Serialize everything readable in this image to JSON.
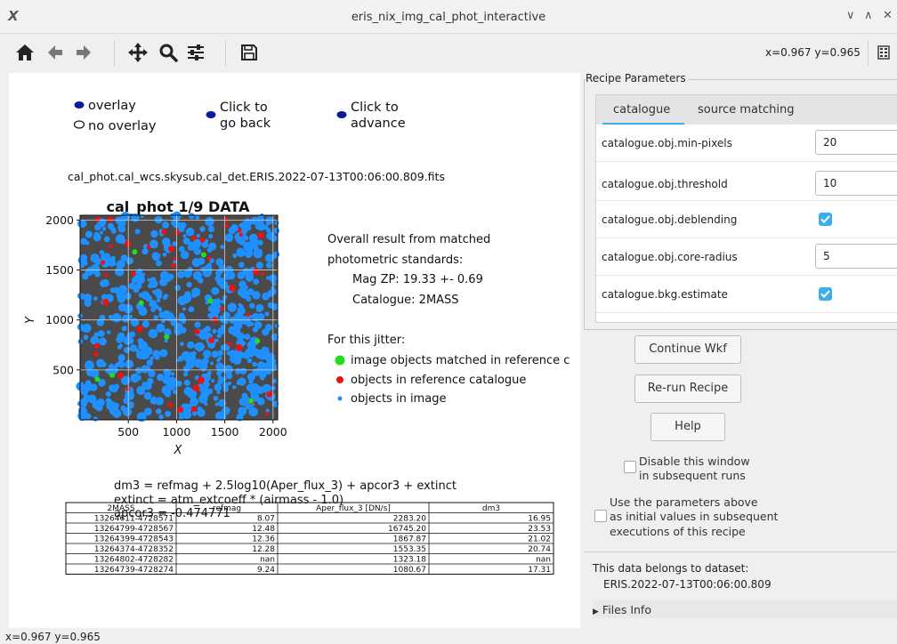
{
  "window": {
    "title": "eris_nix_img_cal_phot_interactive",
    "controls": [
      "∨",
      "∧",
      "✕"
    ]
  },
  "toolbar": {
    "coords": "x=0.967 y=0.965",
    "icons": [
      "home-icon",
      "back-arrow-icon",
      "forward-arrow-icon",
      "pan-icon",
      "zoom-icon",
      "configure-subplots-icon",
      "save-icon"
    ]
  },
  "figure": {
    "buttons": {
      "overlay": "overlay",
      "no_overlay": "no overlay",
      "back": [
        "Click to",
        "go back"
      ],
      "advance": [
        "Click to",
        "advance"
      ]
    },
    "filename": "cal_phot.cal_wcs.skysub.cal_det.ERIS.2022-07-13T00:06:00.809.fits",
    "plot": {
      "title": "cal_phot 1/9 DATA",
      "xlabel": "X",
      "ylabel": "Y",
      "xticks": [
        "500",
        "1000",
        "1500",
        "2000"
      ],
      "yticks": [
        "2000",
        "1500",
        "1000",
        "500"
      ],
      "xtick_values": [
        500,
        1000,
        1500,
        2000
      ],
      "ytick_values": [
        2000,
        1500,
        1000,
        500
      ],
      "xlim": [
        0,
        2048
      ],
      "ylim": [
        0,
        2048
      ]
    },
    "info": {
      "line1": "Overall result from matched",
      "line2": "photometric standards:",
      "line3": "Mag ZP: 19.33 +- 0.69",
      "line4": "Catalogue: 2MASS",
      "line5": "For this jitter:"
    },
    "legend": [
      {
        "label": "image objects matched in reference c",
        "color": "#22dd22"
      },
      {
        "label": "objects in reference catalogue",
        "color": "#ee1111"
      },
      {
        "label": "objects in image",
        "color": "#1e90ff"
      }
    ],
    "formula": {
      "line1": "dm3 = refmag + 2.5log10(Aper_flux_3) + apcor3 + extinct",
      "line2": "extinct = atm_extcoeff * (airmass - 1.0)",
      "line3": "apcor3 = -0.474771"
    },
    "table": {
      "headers": [
        "2MASS",
        "refmag",
        "Aper_flux_3 [DN/s]",
        "dm3"
      ],
      "rows": [
        [
          "13264611-4728571",
          "8.07",
          "2283.20",
          "16.95"
        ],
        [
          "13264799-4728567",
          "12.48",
          "16745.20",
          "23.53"
        ],
        [
          "13264399-4728543",
          "12.36",
          "1867.87",
          "21.02"
        ],
        [
          "13264374-4728352",
          "12.28",
          "1553.35",
          "20.74"
        ],
        [
          "13264802-4728282",
          "nan",
          "1323.18",
          "nan"
        ],
        [
          "13264739-4728274",
          "9.24",
          "1080.67",
          "17.31"
        ]
      ]
    }
  },
  "panel": {
    "legend": "Recipe Parameters",
    "tabs": [
      "catalogue",
      "source matching"
    ],
    "params": [
      {
        "label": "catalogue.obj.min-pixels",
        "value": "20",
        "kind": "text"
      },
      {
        "label": "catalogue.obj.threshold",
        "value": "10",
        "kind": "text"
      },
      {
        "label": "catalogue.obj.deblending",
        "value": "true",
        "kind": "check"
      },
      {
        "label": "catalogue.obj.core-radius",
        "value": "5",
        "kind": "text"
      },
      {
        "label": "catalogue.bkg.estimate",
        "value": "true",
        "kind": "check"
      }
    ],
    "buttons": {
      "continue": "Continue Wkf",
      "rerun": "Re-run Recipe",
      "help": "Help"
    },
    "disable_check": [
      "Disable this window",
      "in subsequent runs"
    ],
    "use_params_check": [
      "Use the parameters above",
      "as initial values in subsequent",
      "executions of this recipe"
    ],
    "dataset_label": "This data belongs to dataset:",
    "dataset_name": "ERIS.2022-07-13T00:06:00.809",
    "files_info": "Files Info"
  },
  "status": "x=0.967 y=0.965",
  "colors": {
    "accent": "#3daee9",
    "image_objects": "#1e90ff",
    "reference": "#ee1111",
    "matched": "#22dd22"
  }
}
